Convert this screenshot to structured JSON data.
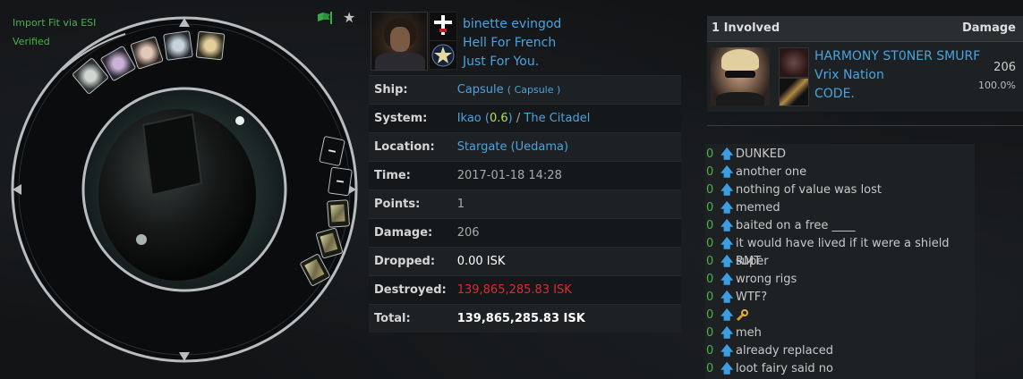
{
  "fitting": {
    "import_label": "Import Fit via ESI",
    "verified_label": "Verified",
    "flag_icon": "flag-icon",
    "favorite_icon": "star-icon"
  },
  "victim": {
    "name": "binette evingod",
    "corporation": "Hell For French",
    "alliance": "Just For You."
  },
  "details": {
    "ship_label": "Ship:",
    "ship_name": "Capsule",
    "ship_group": "Capsule",
    "system_label": "System:",
    "system_name": "Ikao",
    "security": "0.6",
    "region": "The Citadel",
    "location_label": "Location:",
    "location": "Stargate (Uedama)",
    "time_label": "Time:",
    "time": "2017-01-18 14:28",
    "points_label": "Points:",
    "points": "1",
    "damage_label": "Damage:",
    "damage": "206",
    "dropped_label": "Dropped:",
    "dropped": "0.00 ISK",
    "destroyed_label": "Destroyed:",
    "destroyed": "139,865,285.83 ISK",
    "total_label": "Total:",
    "total": "139,865,285.83 ISK",
    "colors": {
      "link": "#4aa3df",
      "security": "#b6e04a",
      "destroyed": "#dd2b2b",
      "dropped": "#ffffff"
    }
  },
  "involved": {
    "header_count": "1 Involved",
    "header_damage": "Damage",
    "attackers": [
      {
        "name": "HARMONY ST0NER SMURF",
        "corporation": "Vrix Nation",
        "alliance": "CODE.",
        "damage": "206",
        "percent": "100.0%"
      }
    ]
  },
  "comments": [
    {
      "count": "0",
      "text": "DUNKED"
    },
    {
      "count": "0",
      "text": "another one"
    },
    {
      "count": "0",
      "text": "nothing of value was lost"
    },
    {
      "count": "0",
      "text": "memed"
    },
    {
      "count": "0",
      "text": "baited on a free ____"
    },
    {
      "count": "0",
      "text": "it would have lived if it were a shield super"
    },
    {
      "count": "0",
      "text": "RMT"
    },
    {
      "count": "0",
      "text": "wrong rigs"
    },
    {
      "count": "0",
      "text": "WTF?"
    },
    {
      "count": "0",
      "text": "",
      "icon": "wrench-emote-icon"
    },
    {
      "count": "0",
      "text": "meh"
    },
    {
      "count": "0",
      "text": "already replaced"
    },
    {
      "count": "0",
      "text": "loot fairy said no"
    }
  ]
}
